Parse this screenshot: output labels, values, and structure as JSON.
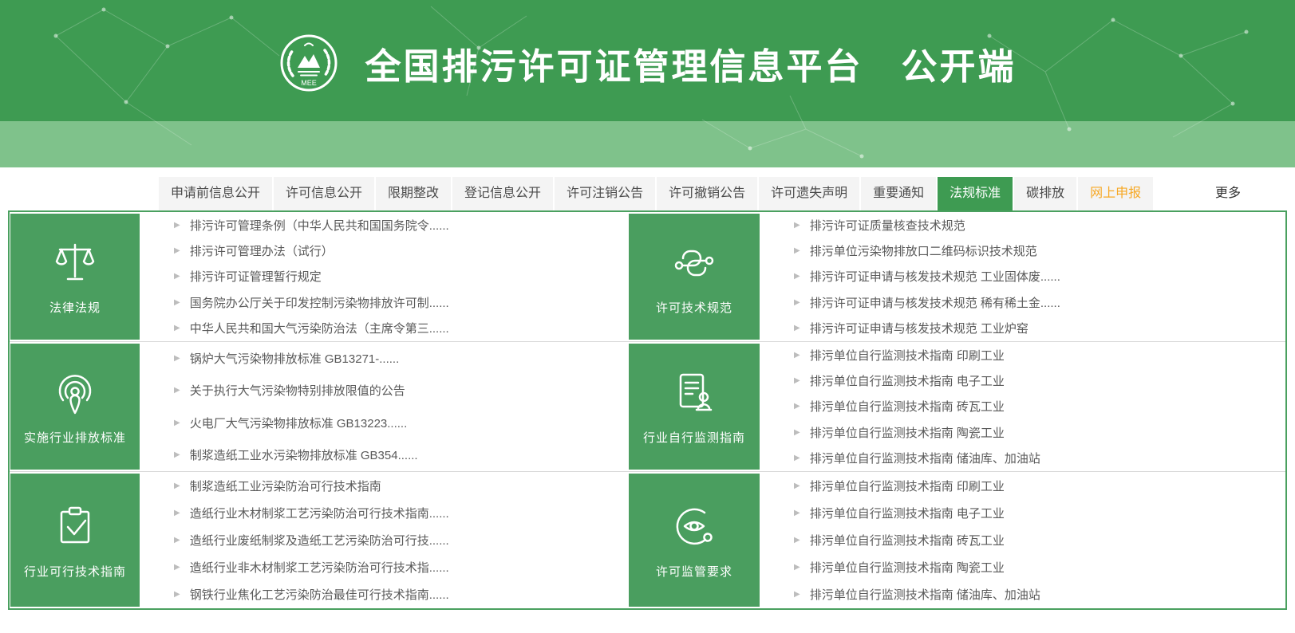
{
  "header": {
    "title": "全国排污许可证管理信息平台　公开端",
    "logo_text": "MEE"
  },
  "tabs": [
    {
      "label": "申请前信息公开"
    },
    {
      "label": "许可信息公开"
    },
    {
      "label": "限期整改"
    },
    {
      "label": "登记信息公开"
    },
    {
      "label": "许可注销公告"
    },
    {
      "label": "许可撤销公告"
    },
    {
      "label": "许可遗失声明"
    },
    {
      "label": "重要通知"
    },
    {
      "label": "法规标准"
    },
    {
      "label": "碳排放"
    },
    {
      "label": "网上申报"
    }
  ],
  "ui": {
    "more_label": "更多",
    "bullet": "▶"
  },
  "colors": {
    "header_green": "#3e9b52",
    "band_green": "#7fc28b",
    "card_green": "#4a9e5f",
    "border_green": "#4aa05f",
    "tab_bg": "#f4f4f4",
    "active_tab_green": "#3e9b52",
    "online_declare_orange": "#f7a824",
    "item_text": "#595959"
  },
  "blocks": [
    {
      "title": "法律法规",
      "icon": "scales-icon",
      "items": [
        "排污许可管理条例（中华人民共和国国务院令......",
        "排污许可管理办法（试行）",
        "排污许可证管理暂行规定",
        "国务院办公厅关于印发控制污染物排放许可制......",
        "中华人民共和国大气污染防治法（主席令第三......"
      ]
    },
    {
      "title": "许可技术规范",
      "icon": "chain-links-icon",
      "items": [
        "排污许可证质量核查技术规范",
        "排污单位污染物排放口二维码标识技术规范",
        "排污许可证申请与核发技术规范 工业固体废......",
        "排污许可证申请与核发技术规范 稀有稀土金......",
        "排污许可证申请与核发技术规范 工业炉窑"
      ]
    },
    {
      "title": "实施行业排放标准",
      "icon": "broadcast-icon",
      "items": [
        "锅炉大气污染物排放标准 GB13271-......",
        "关于执行大气污染物特别排放限值的公告",
        "火电厂大气污染物排放标准 GB13223......",
        "制浆造纸工业水污染物排放标准 GB354......"
      ]
    },
    {
      "title": "行业自行监测指南",
      "icon": "document-person-icon",
      "items": [
        "排污单位自行监测技术指南 印刷工业",
        "排污单位自行监测技术指南 电子工业",
        "排污单位自行监测技术指南 砖瓦工业",
        "排污单位自行监测技术指南 陶瓷工业",
        "排污单位自行监测技术指南 储油库、加油站"
      ]
    },
    {
      "title": "行业可行技术指南",
      "icon": "clipboard-check-icon",
      "items": [
        "制浆造纸工业污染防治可行技术指南",
        "造纸行业木材制浆工艺污染防治可行技术指南......",
        "造纸行业废纸制浆及造纸工艺污染防治可行技......",
        "造纸行业非木材制浆工艺污染防治可行技术指......",
        "钢铁行业焦化工艺污染防治最佳可行技术指南......"
      ]
    },
    {
      "title": "许可监管要求",
      "icon": "eye-circle-icon",
      "items": [
        "排污单位自行监测技术指南 印刷工业",
        "排污单位自行监测技术指南 电子工业",
        "排污单位自行监测技术指南 砖瓦工业",
        "排污单位自行监测技术指南 陶瓷工业",
        "排污单位自行监测技术指南 储油库、加油站"
      ]
    }
  ]
}
